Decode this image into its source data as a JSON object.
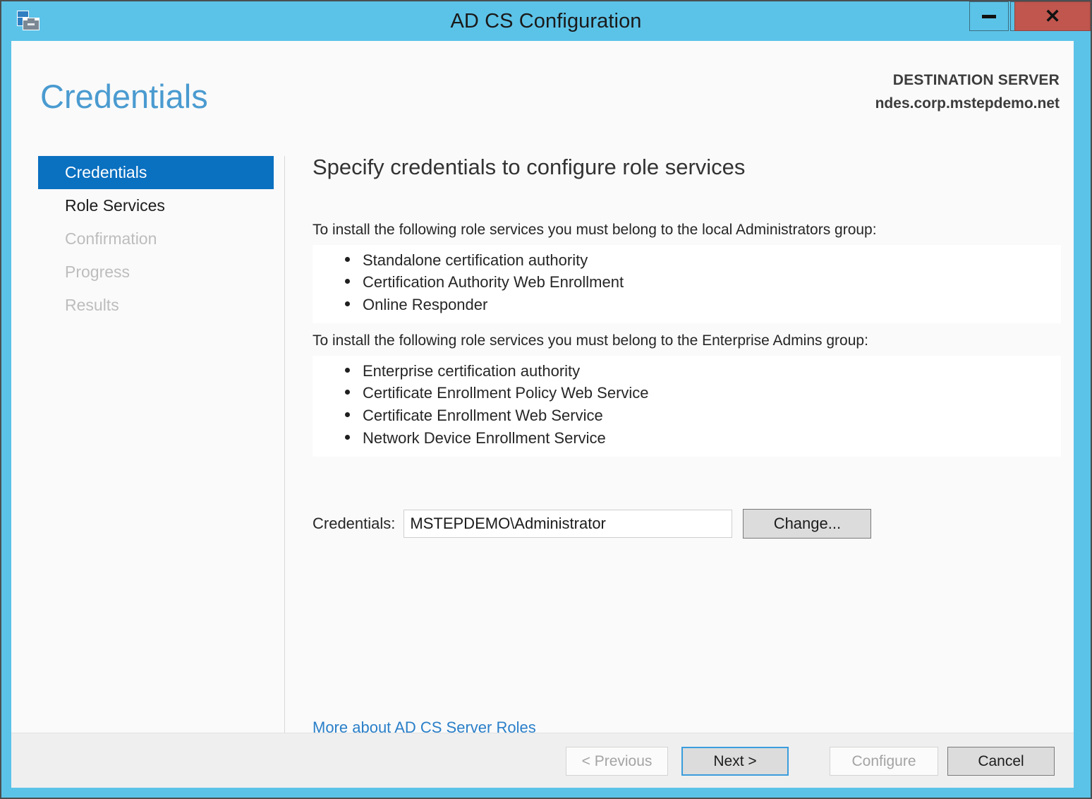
{
  "window": {
    "title": "AD CS Configuration",
    "app_icon": "server-manager-icon",
    "controls": {
      "minimize": "minimize-icon",
      "maximize": "maximize-icon",
      "close": "close-icon"
    },
    "accent_color": "#5cc3e8",
    "close_color": "#c0564e"
  },
  "header": {
    "page_title": "Credentials",
    "destination_label": "DESTINATION SERVER",
    "destination_server": "ndes.corp.mstepdemo.net"
  },
  "sidebar": {
    "items": [
      {
        "label": "Credentials",
        "state": "selected"
      },
      {
        "label": "Role Services",
        "state": "enabled"
      },
      {
        "label": "Confirmation",
        "state": "disabled"
      },
      {
        "label": "Progress",
        "state": "disabled"
      },
      {
        "label": "Results",
        "state": "disabled"
      }
    ]
  },
  "main": {
    "heading": "Specify credentials to configure role services",
    "groups": [
      {
        "intro": "To install the following role services you must belong to the local Administrators group:",
        "items": [
          "Standalone certification authority",
          "Certification Authority Web Enrollment",
          "Online Responder"
        ]
      },
      {
        "intro": "To install the following role services you must belong to the Enterprise Admins group:",
        "items": [
          "Enterprise certification authority",
          "Certificate Enrollment Policy Web Service",
          "Certificate Enrollment Web Service",
          "Network Device Enrollment Service"
        ]
      }
    ],
    "credentials": {
      "label": "Credentials:",
      "value": "MSTEPDEMO\\Administrator",
      "placeholder": "",
      "change_button": "Change..."
    },
    "more_link": "More about AD CS Server Roles"
  },
  "footer": {
    "previous": "< Previous",
    "next": "Next >",
    "configure": "Configure",
    "cancel": "Cancel"
  }
}
